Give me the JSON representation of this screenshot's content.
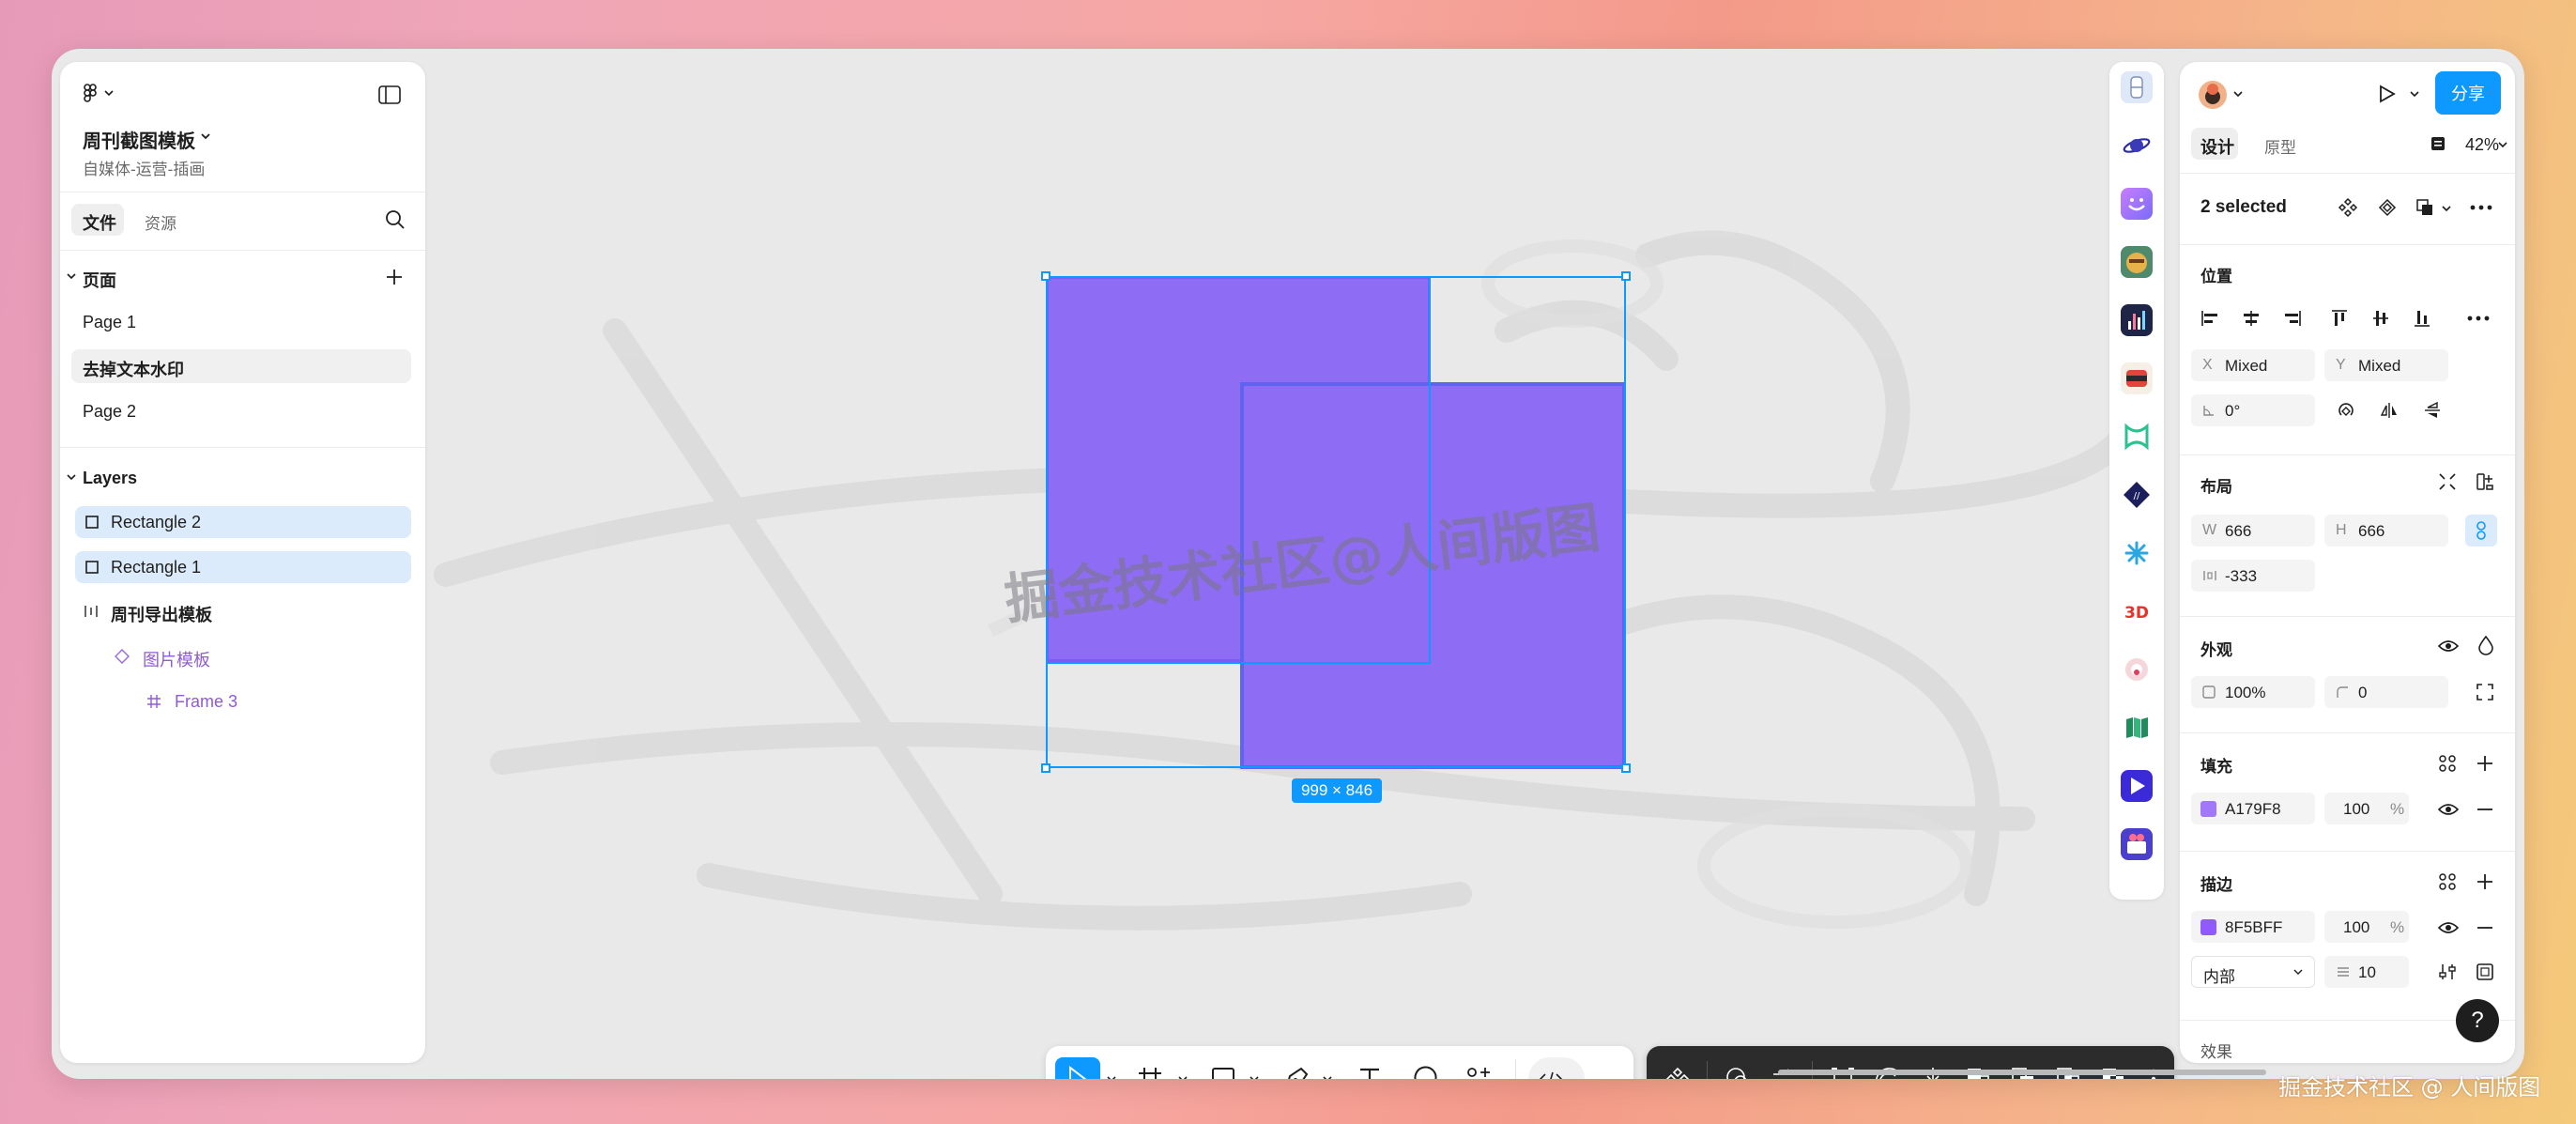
{
  "file": {
    "title": "周刊截图模板",
    "breadcrumb": "自媒体-运营-插画"
  },
  "left_tabs": [
    "文件",
    "资源"
  ],
  "pages_section": {
    "title": "页面",
    "items": [
      "Page 1",
      "去掉文本水印",
      "Page 2"
    ]
  },
  "layers_section": {
    "title": "Layers",
    "items": [
      "Rectangle 2",
      "Rectangle 1",
      "周刊导出模板",
      "图片模板",
      "Frame 3"
    ]
  },
  "canvas": {
    "watermark": "掘金技术社区@人间版图",
    "dimension_badge": "999 × 846",
    "corner_watermark": "掘金技术社区 @ 人间版图"
  },
  "right_panel": {
    "share_label": "分享",
    "mode_tabs": [
      "设计",
      "原型"
    ],
    "zoom": "42%",
    "selection": "2 selected",
    "position": {
      "title": "位置",
      "x_label": "X",
      "x_value": "Mixed",
      "y_label": "Y",
      "y_value": "Mixed",
      "rotation": "0°"
    },
    "layout": {
      "title": "布局",
      "w_label": "W",
      "w_value": "666",
      "h_label": "H",
      "h_value": "666",
      "gap_value": "-333"
    },
    "appearance": {
      "title": "外观",
      "opacity": "100%",
      "radius": "0"
    },
    "fill": {
      "title": "填充",
      "hex": "A179F8",
      "swatch_color": "#A179F8",
      "opacity": "100",
      "unit": "%"
    },
    "stroke": {
      "title": "描边",
      "hex": "8F5BFF",
      "swatch_color": "#8F5BFF",
      "opacity": "100",
      "unit": "%",
      "position": "内部",
      "weight": "10"
    },
    "effects": {
      "title": "效果"
    }
  },
  "help_label": "?",
  "colors": {
    "accent": "#0d99ff",
    "rect_fill": "#8e6cf3",
    "selected_layer_bg": "#dcebfb"
  },
  "icons": {
    "left_header": [
      "figma-logo-icon",
      "sidebar-toggle-icon",
      "search-icon",
      "plus-icon"
    ],
    "toolbar": [
      "move-tool-icon",
      "frame-tool-icon",
      "rectangle-tool-icon",
      "pen-tool-icon",
      "text-tool-icon",
      "comment-tool-icon",
      "actions-icon",
      "dev-mode-icon"
    ],
    "plugins": [
      "plugin-icon-1",
      "plugin-icon-2",
      "plugin-icon-3",
      "plugin-icon-4",
      "plugin-icon-5",
      "plugin-icon-6",
      "plugin-icon-7",
      "plugin-icon-8",
      "plugin-icon-9",
      "plugin-icon-10",
      "plugin-icon-11",
      "plugin-icon-12",
      "plugin-icon-13",
      "plugin-icon-14"
    ]
  }
}
